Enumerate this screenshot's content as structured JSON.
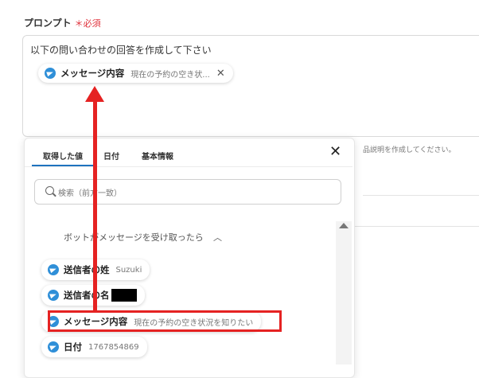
{
  "prompt": {
    "label": "プロンプト",
    "required_mark": "＊必須",
    "text": "以下の問い合わせの回答を作成して下さい",
    "chip": {
      "name": "メッセージ内容",
      "value": "現在の予約の空き状...",
      "remove": "✕"
    }
  },
  "background": {
    "hint": "品説明を作成してください。"
  },
  "panel": {
    "tabs": [
      {
        "label": "取得した値",
        "active": true
      },
      {
        "label": "日付"
      },
      {
        "label": "基本情報"
      }
    ],
    "close": "✕",
    "search": {
      "placeholder": "検索（前方一致）"
    },
    "trigger": {
      "label": "ボットがメッセージを受け取ったら",
      "chevron": "︿"
    },
    "items": [
      {
        "name": "送信者の姓",
        "value": "Suzuki"
      },
      {
        "name": "送信者の名",
        "value": "",
        "redacted": true
      },
      {
        "name": "メッセージ内容",
        "value": "現在の予約の空き状況を知りたい",
        "highlighted": true
      },
      {
        "name": "日付",
        "value": "1767854869"
      }
    ]
  },
  "colors": {
    "accent": "#1e73be",
    "telegram": "#2f8fd8",
    "annotation": "#e52222",
    "required": "#e0323c"
  }
}
